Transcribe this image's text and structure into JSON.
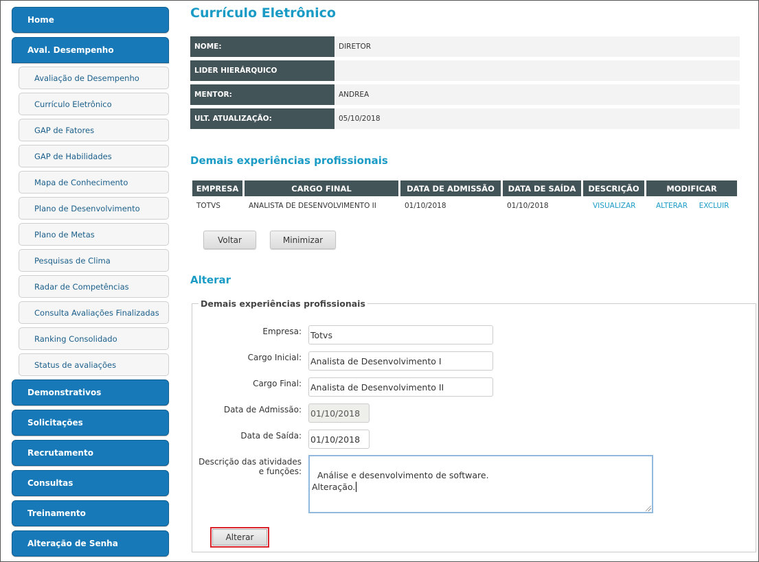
{
  "sidebar": {
    "top_items": [
      {
        "label": "Home"
      },
      {
        "label": "Aval. Desempenho"
      }
    ],
    "sub_items": [
      {
        "label": "Avaliação de Desempenho"
      },
      {
        "label": "Currículo Eletrônico"
      },
      {
        "label": "GAP de Fatores"
      },
      {
        "label": "GAP de Habilidades"
      },
      {
        "label": "Mapa de Conhecimento"
      },
      {
        "label": "Plano de Desenvolvimento"
      },
      {
        "label": "Plano de Metas"
      },
      {
        "label": "Pesquisas de Clima"
      },
      {
        "label": "Radar de Competências"
      },
      {
        "label": "Consulta Avaliações Finalizadas"
      },
      {
        "label": "Ranking Consolidado"
      },
      {
        "label": "Status de avaliações"
      }
    ],
    "bottom_items": [
      {
        "label": "Demonstrativos"
      },
      {
        "label": "Solicitações"
      },
      {
        "label": "Recrutamento"
      },
      {
        "label": "Consultas"
      },
      {
        "label": "Treinamento"
      },
      {
        "label": "Alteração de Senha"
      }
    ]
  },
  "page": {
    "title": "Currículo Eletrônico"
  },
  "info": {
    "rows": [
      {
        "label": "NOME:",
        "value": "DIRETOR"
      },
      {
        "label": "LIDER HIERÁRQUICO",
        "value": ""
      },
      {
        "label": "MENTOR:",
        "value": "ANDREA"
      },
      {
        "label": "ULT. ATUALIZAÇÃO:",
        "value": "05/10/2018"
      }
    ]
  },
  "experiences": {
    "title": "Demais experiências profissionais",
    "headers": [
      "EMPRESA",
      "CARGO FINAL",
      "DATA DE ADMISSÃO",
      "DATA DE SAÍDA",
      "DESCRIÇÃO",
      "MODIFICAR"
    ],
    "rows": [
      {
        "empresa": "TOTVS",
        "cargo_final": "ANALISTA DE DESENVOLVIMENTO II",
        "admissao": "01/10/2018",
        "saida": "01/10/2018",
        "descricao": "VISUALIZAR",
        "alterar": "ALTERAR",
        "excluir": "EXCLUIR"
      }
    ],
    "back_label": "Voltar",
    "minimize_label": "Minimizar"
  },
  "form": {
    "section_title": "Alterar",
    "legend": "Demais experiências profissionais",
    "empresa_label": "Empresa:",
    "empresa_value": "Totvs",
    "cargo_inicial_label": "Cargo Inicial:",
    "cargo_inicial_value": "Analista de Desenvolvimento I",
    "cargo_final_label": "Cargo Final:",
    "cargo_final_value": "Analista de Desenvolvimento II",
    "admissao_label": "Data de Admissão:",
    "admissao_value": "01/10/2018",
    "saida_label": "Data de Saída:",
    "saida_value": "01/10/2018",
    "descricao_label_1": "Descrição das atividades",
    "descricao_label_2": "e funções:",
    "descricao_value": "Análise e desenvolvimento de software.\nAlteração.",
    "submit_label": "Alterar"
  },
  "colors": {
    "nav_blue": "#1779b8",
    "title_blue": "#1a9bc6",
    "header_dark": "#435459",
    "highlight_red": "#d9222a"
  }
}
